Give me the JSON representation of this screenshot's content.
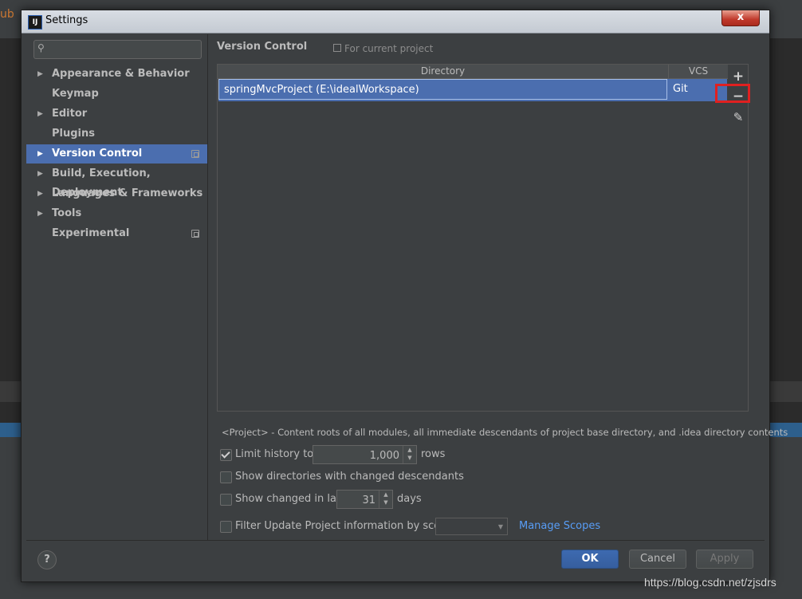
{
  "background": {
    "orange_text": "ub"
  },
  "window": {
    "title": "Settings",
    "close_label": "x",
    "app_icon_label": "IJ"
  },
  "search": {
    "placeholder": ""
  },
  "sidebar": {
    "items": [
      {
        "label": "Appearance & Behavior",
        "expandable": true
      },
      {
        "label": "Keymap",
        "expandable": false
      },
      {
        "label": "Editor",
        "expandable": true
      },
      {
        "label": "Plugins",
        "expandable": false
      },
      {
        "label": "Version Control",
        "expandable": true,
        "selected": true,
        "project_scoped": true
      },
      {
        "label": "Build, Execution, Deployment",
        "expandable": true
      },
      {
        "label": "Languages & Frameworks",
        "expandable": true
      },
      {
        "label": "Tools",
        "expandable": true
      },
      {
        "label": "Experimental",
        "expandable": false,
        "project_scoped": true
      }
    ]
  },
  "content": {
    "title": "Version Control",
    "scope_label": "For current project",
    "table": {
      "columns": [
        "Directory",
        "VCS"
      ],
      "rows": [
        {
          "directory": "springMvcProject (E:\\idealWorkspace)",
          "vcs": "Git"
        }
      ]
    },
    "toolbar": {
      "add": "+",
      "remove": "−",
      "edit": "✎"
    },
    "note": "<Project> - Content roots of all modules, all immediate descendants of project base directory, and .idea directory contents",
    "options": {
      "limit_history": {
        "label": "Limit history to:",
        "checked": true,
        "value": "1,000",
        "unit": "rows"
      },
      "show_dirs": {
        "label": "Show directories with changed descendants",
        "checked": false
      },
      "show_changed": {
        "label": "Show changed in last",
        "checked": false,
        "value": "31",
        "unit": "days"
      },
      "filter_update": {
        "label": "Filter Update Project information by scope",
        "checked": false,
        "scope_value": ""
      },
      "manage_scopes": "Manage Scopes"
    }
  },
  "buttons": {
    "help": "?",
    "ok": "OK",
    "cancel": "Cancel",
    "apply": "Apply"
  },
  "watermark": "https://blog.csdn.net/zjsdrs",
  "colors": {
    "selection": "#4b6eaf",
    "highlight": "#e02020",
    "link": "#589df6"
  }
}
